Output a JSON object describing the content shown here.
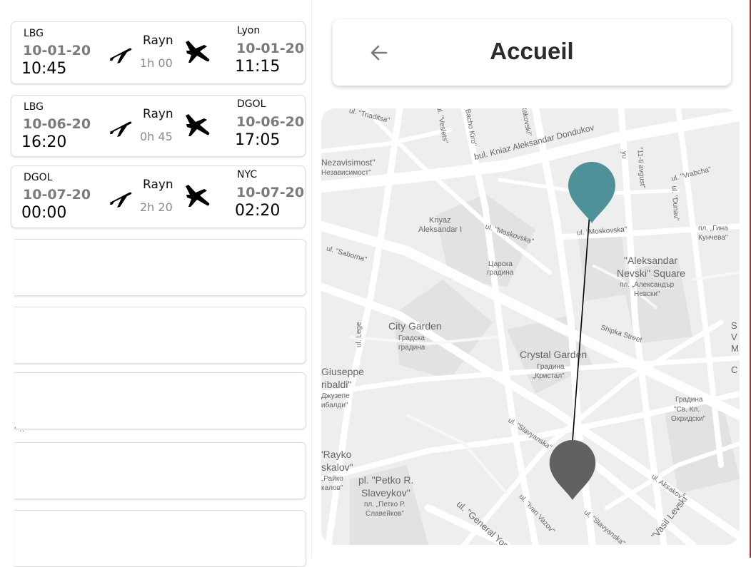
{
  "flights": [
    {
      "from_code": "LBG",
      "from_date": "10-01-20",
      "from_time": "10:45",
      "airline": "Rayn",
      "duration": "1h 00",
      "to_code": "Lyon",
      "to_date": "10-01-20",
      "to_time": "11:15"
    },
    {
      "from_code": "LBG",
      "from_date": "10-06-20",
      "from_time": "16:20",
      "airline": "Rayn",
      "duration": "0h 45",
      "to_code": "DGOL",
      "to_date": "10-06-20",
      "to_time": "17:05"
    },
    {
      "from_code": "DGOL",
      "from_date": "10-07-20",
      "from_time": "00:00",
      "airline": "Rayn",
      "duration": "2h 20",
      "to_code": "NYC",
      "to_date": "10-07-20",
      "to_time": "02:20"
    }
  ],
  "stray_text": "' ..",
  "header": {
    "title": "Accueil",
    "back_icon": "arrow-left-icon"
  },
  "map": {
    "origin_pin_color": "#4f9198",
    "destination_pin_color": "#616161",
    "labels": {
      "triaditsa": "ul. \"Triaditsa\"",
      "veslets": "ul. \"Veslets\"",
      "bacho": "\"Bacho Kiro\"",
      "rakovski": "\"Rakovski\"",
      "nezavisimost": "Nezavisimost\"",
      "nezavisimost_cyr": "Независимост\"",
      "dondukov": "bul. Kniaz Aleksandar Dondukov",
      "yuri": "\"11-ti avgust\"",
      "vrabcha": "ul. \"Vrabcha\"",
      "dunav": "ul. \"Dunav\"",
      "gina": "пл. „Гина",
      "gina2": "Кунчева\"",
      "knyaz": "Knyaz",
      "knyaz2": "Aleksandar I",
      "moskovska1": "ul. \"Moskovska\"",
      "moskovska2": "ul. \"Moskovska\"",
      "saborna": "ul. \"Saborna\"",
      "tsarska": "Царска",
      "tsarska2": "градина",
      "nevski": "\"Aleksandar",
      "nevski2": "Nevski\" Square",
      "nevski3": "пл. „Александър",
      "nevski4": "Невски\"",
      "legue": "ul. Lege",
      "city_garden": "City Garden",
      "city_garden2": "Градска",
      "city_garden3": "градина",
      "shipka": "Shipka Street",
      "crystal": "Crystal Garden",
      "crystal2": "Градина",
      "crystal3": "„Кристал\"",
      "giuseppe": "Giuseppe",
      "giuseppe2": "ribaldi\"",
      "giuseppe3": "Джузепе",
      "giuseppe4": "ибалди\"",
      "ohridski": "Градина",
      "ohridski2": "\"Св. Кл.",
      "ohridski3": "Охридски\"",
      "slavyanska": "ul. \"Slavyanska\"",
      "rayko": "'Rayko",
      "rayko2": "skalov\"",
      "rayko3": "„Райко",
      "rayko4": "калов\"",
      "petko": "pl. \"Petko R.",
      "petko2": "Slaveykov\"",
      "petko3": "пл. „Петко Р.",
      "petko4": "Славейков\"",
      "general": "ul. \"General Yosif",
      "vazov": "ul. \"Ivan Vazov\"",
      "slavyanska2": "ul. \"Slavyanska\"",
      "aksakov": "ul. Aksakov",
      "levski": "\"Vasil Levski\"",
      "ivanmir": "ul. \"Ivan...",
      "yu": "yu",
      "sv": "S",
      "sv2": "V",
      "sv3": "M",
      "sv4": "C"
    }
  }
}
